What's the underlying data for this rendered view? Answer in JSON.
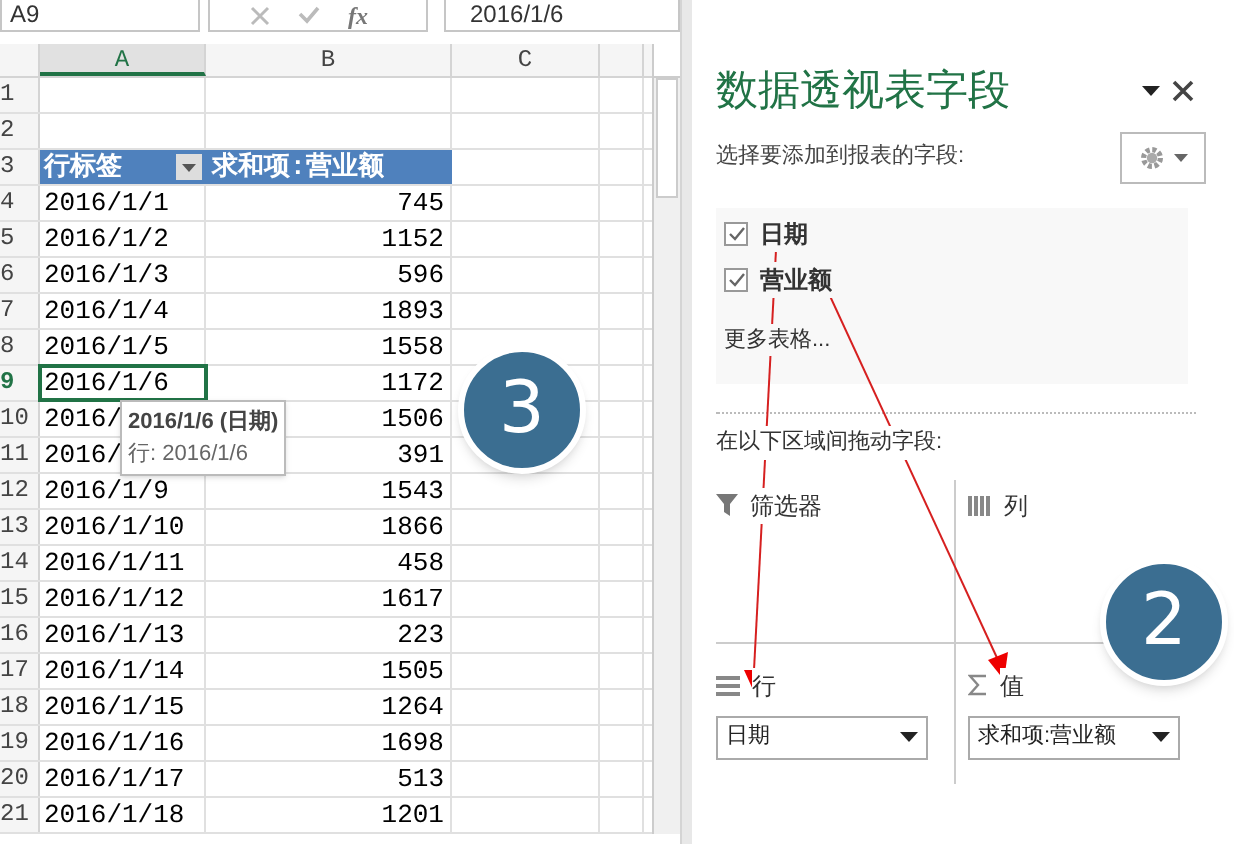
{
  "formula_bar": {
    "name_box": "A9",
    "function_label": "fx",
    "formula": "2016/1/6"
  },
  "sheet": {
    "columns": [
      {
        "label": "A",
        "selected": true
      },
      {
        "label": "B",
        "selected": false
      },
      {
        "label": "C",
        "selected": false
      },
      {
        "selected": false
      }
    ],
    "rows": [
      {
        "num": "1",
        "kind": "plain",
        "selected": false
      },
      {
        "num": "2",
        "kind": "plain",
        "selected": false
      },
      {
        "num": "3",
        "a": "行标签",
        "b": "求和项:营业额",
        "kind": "header",
        "selected": false
      },
      {
        "num": "4",
        "a": "2016/1/1",
        "b": "745",
        "kind": "plain",
        "selected": false
      },
      {
        "num": "5",
        "a": "2016/1/2",
        "b": "1152",
        "kind": "plain",
        "selected": false
      },
      {
        "num": "6",
        "a": "2016/1/3",
        "b": "596",
        "kind": "plain",
        "selected": false
      },
      {
        "num": "7",
        "a": "2016/1/4",
        "b": "1893",
        "kind": "plain",
        "selected": false
      },
      {
        "num": "8",
        "a": "2016/1/5",
        "b": "1558",
        "kind": "plain",
        "selected": false
      },
      {
        "num": "9",
        "a": "2016/1/6",
        "b": "1172",
        "kind": "plain",
        "selected": true
      },
      {
        "num": "10",
        "a": "2016/",
        "b": "1506",
        "kind": "plain",
        "selected": false
      },
      {
        "num": "11",
        "a": "2016/",
        "b": "391",
        "kind": "plain",
        "selected": false
      },
      {
        "num": "12",
        "a": "2016/1/9",
        "b": "1543",
        "kind": "plain",
        "selected": false
      },
      {
        "num": "13",
        "a": "2016/1/10",
        "b": "1866",
        "kind": "plain",
        "selected": false
      },
      {
        "num": "14",
        "a": "2016/1/11",
        "b": "458",
        "kind": "plain",
        "selected": false
      },
      {
        "num": "15",
        "a": "2016/1/12",
        "b": "1617",
        "kind": "plain",
        "selected": false
      },
      {
        "num": "16",
        "a": "2016/1/13",
        "b": "223",
        "kind": "plain",
        "selected": false
      },
      {
        "num": "17",
        "a": "2016/1/14",
        "b": "1505",
        "kind": "plain",
        "selected": false
      },
      {
        "num": "18",
        "a": "2016/1/15",
        "b": "1264",
        "kind": "plain",
        "selected": false
      },
      {
        "num": "19",
        "a": "2016/1/16",
        "b": "1698",
        "kind": "plain",
        "selected": false
      },
      {
        "num": "20",
        "a": "2016/1/17",
        "b": "513",
        "kind": "plain",
        "selected": false
      },
      {
        "num": "21",
        "a": "2016/1/18",
        "b": "1201",
        "kind": "plain",
        "selected": false
      }
    ],
    "tooltip": {
      "title": "2016/1/6 (日期)",
      "line": "行: 2016/1/6"
    }
  },
  "panel": {
    "title": "数据透视表字段",
    "prompt": "选择要添加到报表的字段:",
    "fields": [
      {
        "label": "日期",
        "checked": true
      },
      {
        "label": "营业额",
        "checked": true
      }
    ],
    "more_tables": "更多表格...",
    "areas_prompt": "在以下区域间拖动字段:",
    "areas": [
      {
        "kind": "filter",
        "label": "筛选器"
      },
      {
        "kind": "columns",
        "label": "列"
      },
      {
        "kind": "rows",
        "label": "行",
        "item": "日期"
      },
      {
        "kind": "values",
        "label": "值",
        "item": "求和项:营业额"
      }
    ]
  },
  "badges": [
    {
      "text": "3"
    },
    {
      "text": "2"
    }
  ]
}
